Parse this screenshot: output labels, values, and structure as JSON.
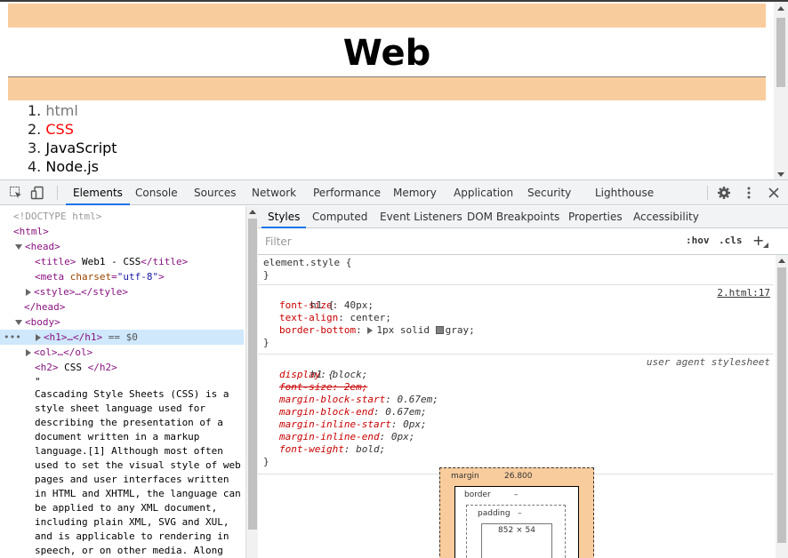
{
  "page": {
    "heading": "Web",
    "list": [
      {
        "num": "1.",
        "label": "html",
        "color": "#777777"
      },
      {
        "num": "2.",
        "label": "CSS",
        "color": "#ff0000"
      },
      {
        "num": "3.",
        "label": "JavaScript",
        "color": "#000000"
      },
      {
        "num": "4.",
        "label": "Node.js",
        "color": "#000000"
      }
    ]
  },
  "devtools": {
    "tabs": [
      "Elements",
      "Console",
      "Sources",
      "Network",
      "Performance",
      "Memory",
      "Application",
      "Security",
      "Lighthouse"
    ],
    "active_tab": "Elements",
    "icons": [
      "inspect-icon",
      "device-toggle-icon",
      "settings-gear-icon",
      "more-vert-icon",
      "close-icon"
    ]
  },
  "dom": {
    "doctype": "<!DOCTYPE html>",
    "html_open": "<html>",
    "head_open": "<head>",
    "title_open": "<title>",
    "title_text": " Web1 - CSS",
    "title_close": "</title>",
    "meta_open": "<meta ",
    "meta_attr": "charset",
    "meta_val": "\"utf-8\"",
    "meta_close": ">",
    "style_line": "<style>…</style>",
    "head_close": "</head>",
    "body_open": "<body>",
    "h1_line": "<h1>…</h1>",
    "h1_suffix": " == $0",
    "ol_line": "<ol>…</ol>",
    "h2_open": "<h2>",
    "h2_text": " CSS ",
    "h2_close": "</h2>",
    "quote": "\"",
    "text_node": "Cascading Style Sheets (CSS) is a style sheet language used for describing the presentation of a document written in a markup language.[1] Although most often used to set the visual style of web pages and user interfaces written in HTML and XHTML, the language can be applied to any XML document, including plain XML, SVG and XUL, and is applicable to rendering in speech, or on other media. Along"
  },
  "styles": {
    "subtabs": [
      "Styles",
      "Computed",
      "Event Listeners",
      "DOM Breakpoints",
      "Properties",
      "Accessibility"
    ],
    "active_subtab": "Styles",
    "filter_placeholder": "Filter",
    "hov": ":hov",
    "cls": ".cls",
    "add": "+",
    "element_style_selector": "element.style {",
    "close_brace": "}",
    "rule1": {
      "selector": "h1 {",
      "source": "2.html:17",
      "decls": [
        {
          "name": "font-size",
          "value": "40px;"
        },
        {
          "name": "text-align",
          "value": "center;"
        },
        {
          "name": "border-bottom",
          "value": "1px solid ",
          "color_name": "gray;"
        }
      ]
    },
    "rule2": {
      "selector": "h1 {",
      "source": "user agent stylesheet",
      "decls": [
        {
          "name": "display",
          "value": "block;"
        },
        {
          "name": "font-size",
          "value": "2em;",
          "struck": true
        },
        {
          "name": "margin-block-start",
          "value": "0.67em;"
        },
        {
          "name": "margin-block-end",
          "value": "0.67em;"
        },
        {
          "name": "margin-inline-start",
          "value": "0px;"
        },
        {
          "name": "margin-inline-end",
          "value": "0px;"
        },
        {
          "name": "font-weight",
          "value": "bold;"
        }
      ]
    }
  },
  "box_model": {
    "margin_label": "margin",
    "margin_value": "26.800",
    "border_label": "border",
    "border_value": "–",
    "padding_label": "padding",
    "padding_value": "–",
    "content_size": "852 × 54"
  },
  "colors": {
    "margin_band": "#f9cc9d",
    "accent": "#1a73e8",
    "selected_row": "#cfe8fc"
  }
}
